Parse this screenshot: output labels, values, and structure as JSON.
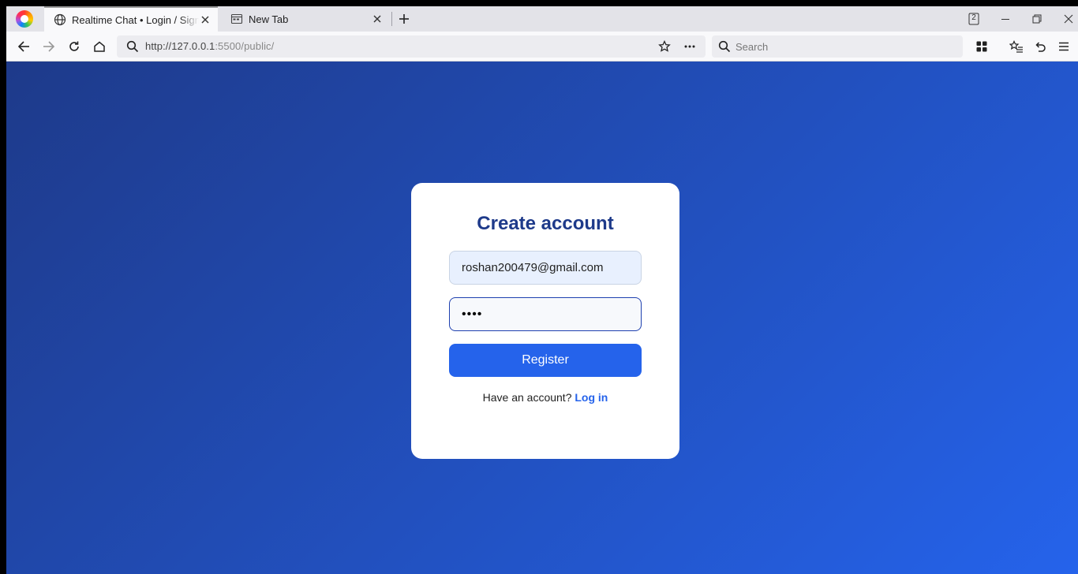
{
  "browser": {
    "tabs": [
      {
        "label": "Realtime Chat • Login / Sign-Up",
        "active": true
      },
      {
        "label": "New Tab",
        "active": false
      }
    ],
    "tab_count_badge": "2",
    "url_host": "http://127.0.0.1",
    "url_rest": ":5500/public/",
    "search_placeholder": "Search"
  },
  "page": {
    "title": "Create account",
    "email_value": "roshan200479@gmail.com",
    "password_value": "1234",
    "register_label": "Register",
    "have_account_text": "Have an account?",
    "login_link": "Log in",
    "colors": {
      "gradient_start": "#1e3a8a",
      "gradient_end": "#2563eb",
      "accent": "#2563eb",
      "title": "#1e3a8a"
    }
  }
}
